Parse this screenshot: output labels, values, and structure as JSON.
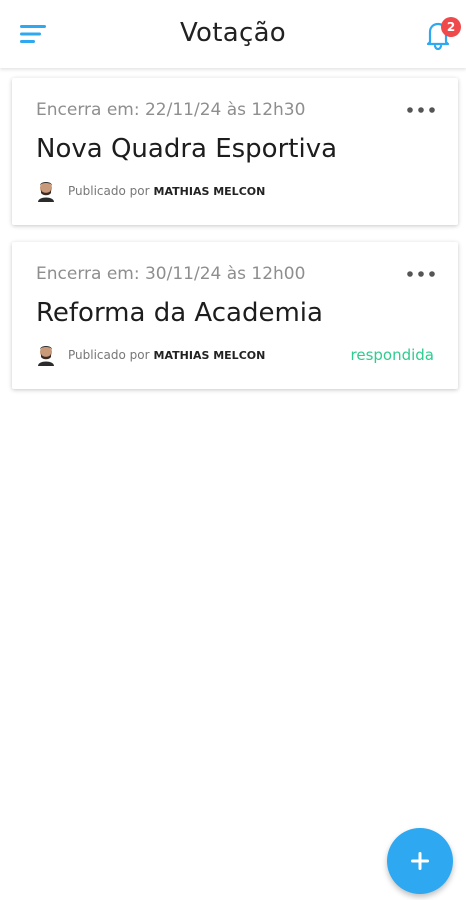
{
  "header": {
    "title": "Votação",
    "notification_count": "2"
  },
  "colors": {
    "accent": "#2ea8f0",
    "badge": "#f0494b",
    "status_answered": "#2ecc8f"
  },
  "polls": [
    {
      "closing": "Encerra em: 22/11/24 às 12h30",
      "title": "Nova Quadra Esportiva",
      "published_by_label": "Publicado por",
      "author": "MATHIAS MELCON",
      "status": ""
    },
    {
      "closing": "Encerra em: 30/11/24 às 12h00",
      "title": "Reforma da Academia",
      "published_by_label": "Publicado por",
      "author": "MATHIAS MELCON",
      "status": "respondida"
    }
  ],
  "icons": {
    "menu": "menu-icon",
    "notifications": "bell-icon",
    "more": "more-horizontal-icon",
    "add": "plus-icon"
  }
}
